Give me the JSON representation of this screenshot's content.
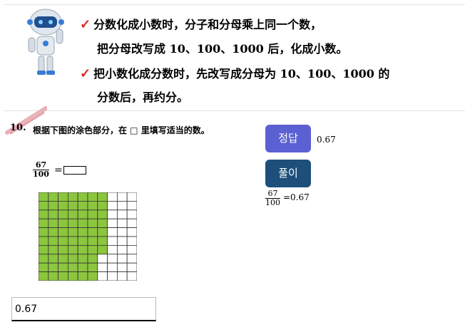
{
  "tips": {
    "line1": "分数化成小数时，分子和分母乘上同一个数，",
    "line2": "把分母改写成 10、100、1000 后，化成小数。",
    "line3": "把小数化成分数时，先改写成分母为 10、100、1000 的",
    "line4": "分数后，再约分。",
    "check_color": "#e0241b"
  },
  "question": {
    "number": "10.",
    "text": "根据下图的涂色部分，在 □ 里填写适当的数。",
    "fraction": {
      "numerator": "67",
      "denominator": "100"
    },
    "equals": "="
  },
  "grid": {
    "rows": 10,
    "cols": 10,
    "shaded": 67,
    "shade_color": "#8cc63e"
  },
  "buttons": {
    "answer_label": "정답",
    "answer_value": "0.67",
    "explain_label": "풀이",
    "explain_text": "=0.67"
  },
  "answer_input": {
    "value": "0.67"
  }
}
